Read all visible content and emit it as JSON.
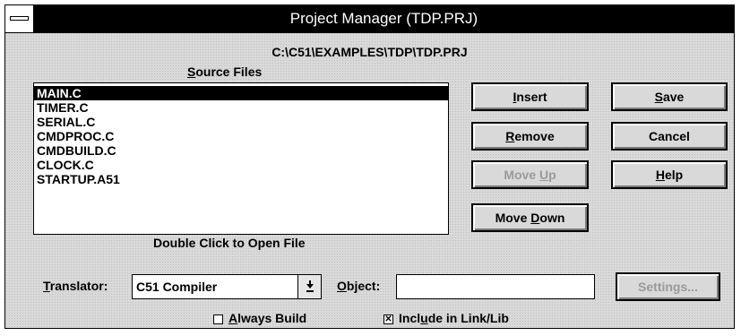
{
  "window": {
    "title": "Project Manager (TDP.PRJ)"
  },
  "project_path": "C:\\C51\\EXAMPLES\\TDP\\TDP.PRJ",
  "source_files": {
    "label_pre": "",
    "label_key": "S",
    "label_post": "ource Files",
    "items": [
      "MAIN.C",
      "TIMER.C",
      "SERIAL.C",
      "CMDPROC.C",
      "CMDBUILD.C",
      "CLOCK.C",
      "STARTUP.A51"
    ],
    "selected_index": 0,
    "hint": "Double Click to Open File"
  },
  "buttons": {
    "insert": {
      "pre": "",
      "key": "I",
      "post": "nsert"
    },
    "remove": {
      "pre": "",
      "key": "R",
      "post": "emove"
    },
    "move_up": {
      "pre": "Move ",
      "key": "U",
      "post": "p"
    },
    "move_down": {
      "pre": "Move ",
      "key": "D",
      "post": "own"
    },
    "save": {
      "pre": "",
      "key": "S",
      "post": "ave"
    },
    "cancel": {
      "label": "Cancel"
    },
    "help": {
      "pre": "",
      "key": "H",
      "post": "elp"
    },
    "settings": {
      "label": "Settings..."
    }
  },
  "translator": {
    "label_key": "T",
    "label_post": "ranslator:",
    "value": "C51 Compiler"
  },
  "object": {
    "label_key": "O",
    "label_post": "bject:",
    "value": ""
  },
  "options": {
    "always_build": {
      "key": "A",
      "post": "lways Build",
      "checked": false,
      "mark": ""
    },
    "include_link": {
      "pre": "Incl",
      "key": "u",
      "post": "de in Link/Lib",
      "checked": true,
      "mark": "✕"
    }
  }
}
